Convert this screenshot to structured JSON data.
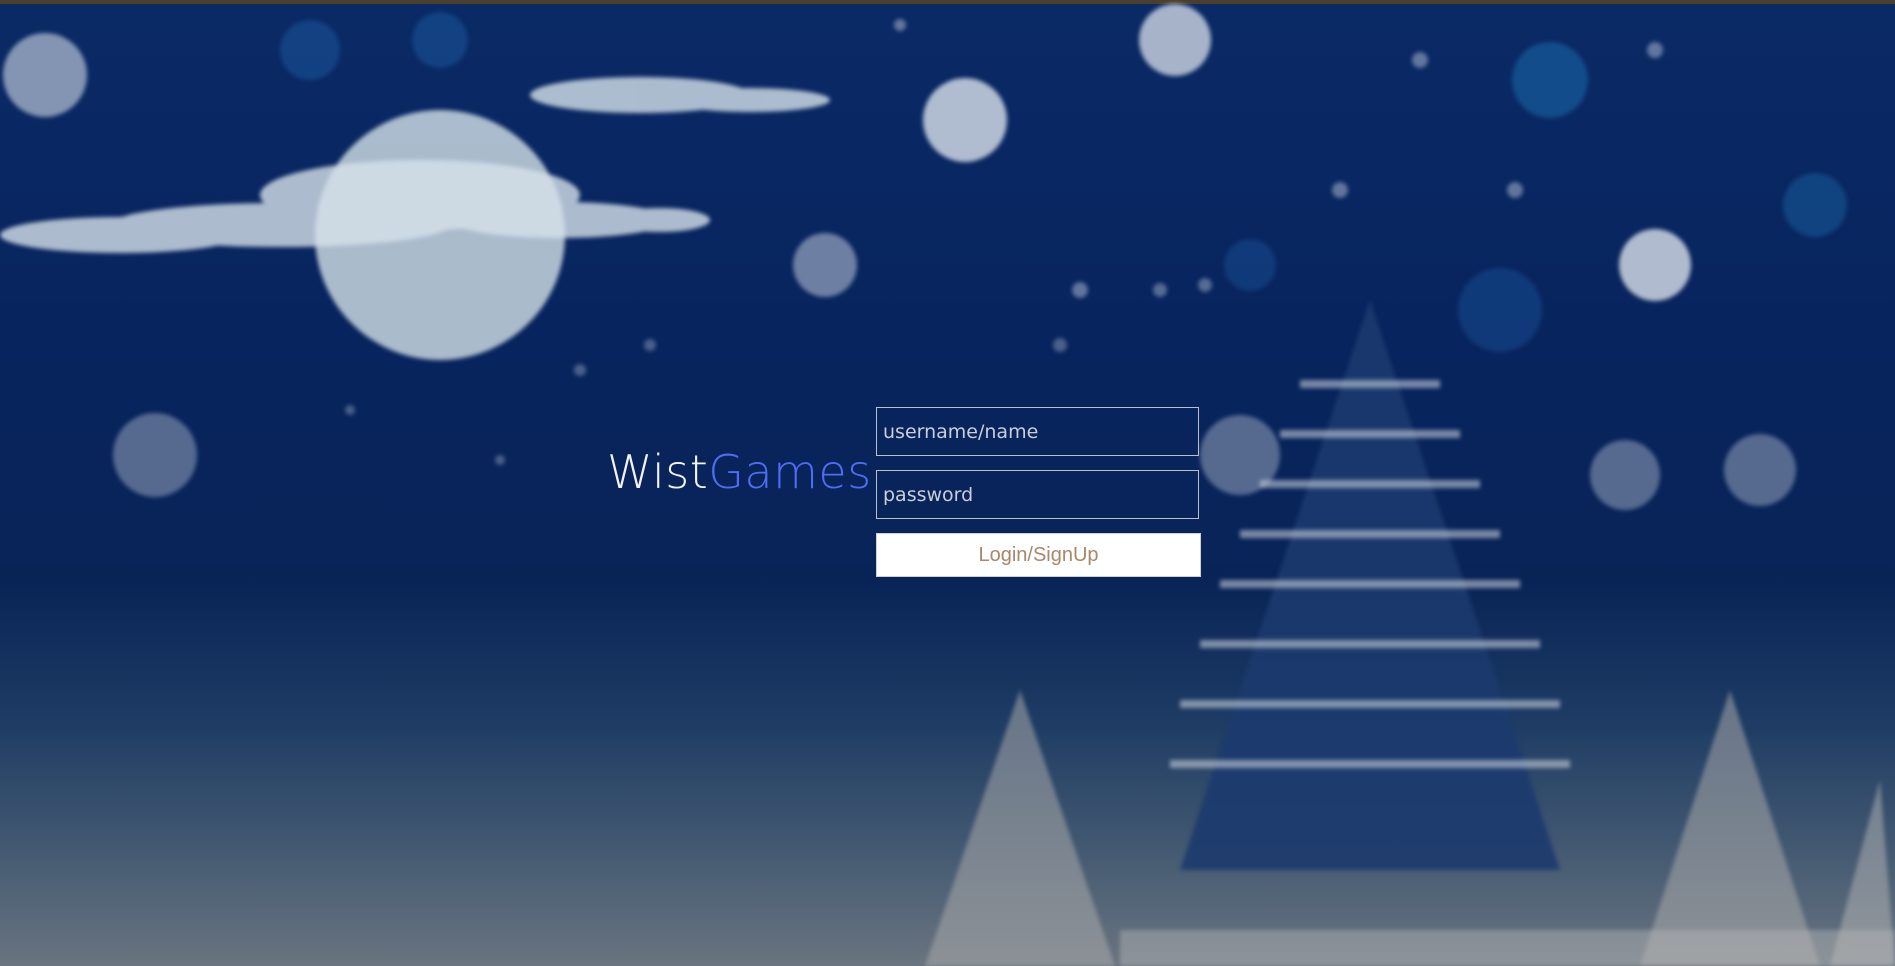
{
  "brand": {
    "part1": "Wist",
    "part2": "Games",
    "part1_color": "#f2f4fa",
    "part2_color": "#4f6cf5"
  },
  "form": {
    "username_placeholder": "username/name",
    "username_value": "",
    "password_placeholder": "password",
    "password_value": "",
    "submit_label": "Login/SignUp"
  },
  "background": {
    "theme": "blurred winter night scene with moon, clouds, snowflakes and pine trees",
    "sky_color": "#0a2a66",
    "ground_color": "#6a7480"
  }
}
